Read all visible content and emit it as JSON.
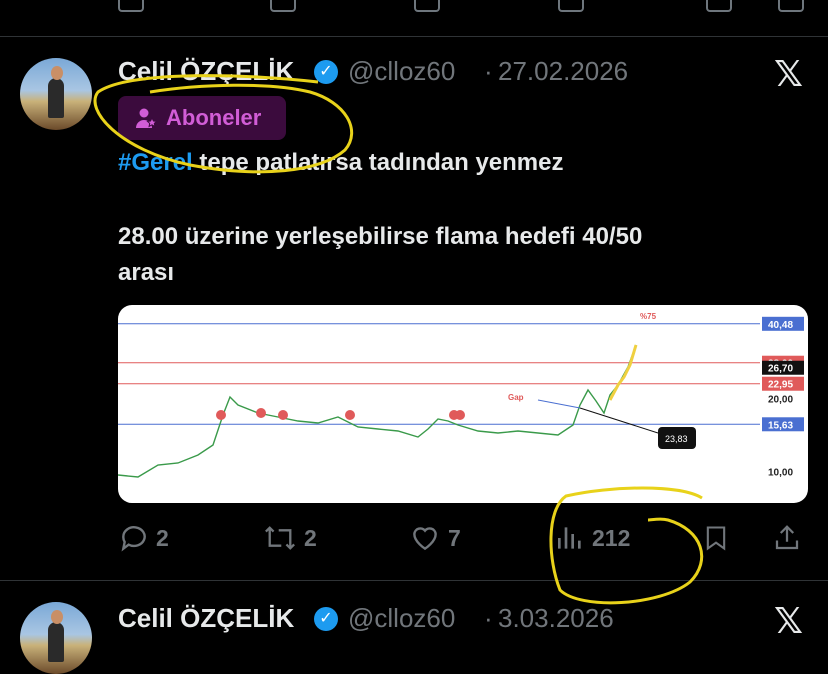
{
  "tweet1": {
    "author_name": "Celil ÖZÇELİK",
    "handle": "@clloz60",
    "date": "27.02.2026",
    "separator": "·",
    "badge_label": "Aboneler",
    "text_hashtag": "#Gerel",
    "text_line1_rest": " tepe patlatırsa tadından yenmez",
    "text_line2": "28.00 üzerine yerleşebilirse flama hedefi 40/50",
    "text_line3": "arası",
    "stats": {
      "replies": "2",
      "reposts": "2",
      "likes": "7",
      "views": "212"
    }
  },
  "tweet2": {
    "author_name": "Celil ÖZÇELİK",
    "handle": "@clloz60",
    "date": "3.03.2026",
    "separator": "·"
  },
  "chart_data": {
    "type": "line",
    "annotation_pct": "%75",
    "gap_label": "Gap",
    "callout_value": "23,83",
    "levels": [
      {
        "label": "40,48",
        "value": 40.48,
        "color": "#4a6fd1",
        "boxed": true
      },
      {
        "label": "28,00",
        "value": 28.0,
        "color": "#e05a5a",
        "boxed": true
      },
      {
        "label": "26,70",
        "value": 26.7,
        "color": "#111111",
        "boxed": true
      },
      {
        "label": "22,95",
        "value": 22.95,
        "color": "#e05a5a",
        "boxed": true
      },
      {
        "label": "20,00",
        "value": 20.0,
        "color": "#555555",
        "boxed": false
      },
      {
        "label": "15,63",
        "value": 15.63,
        "color": "#4a6fd1",
        "boxed": true
      },
      {
        "label": "10,00",
        "value": 10.0,
        "color": "#555555",
        "boxed": false
      }
    ],
    "ylim": [
      8,
      44
    ]
  },
  "colors": {
    "accent": "#1d9bf0",
    "badge_text": "#d15dd6",
    "badge_bg": "#3b0b3d",
    "muted": "#71767b",
    "highlight": "#e8d21a"
  },
  "icons": [
    "reply-icon",
    "repost-icon",
    "like-icon",
    "views-icon",
    "bookmark-icon",
    "share-icon",
    "x-logo-icon",
    "verified-icon",
    "subscribers-icon"
  ]
}
